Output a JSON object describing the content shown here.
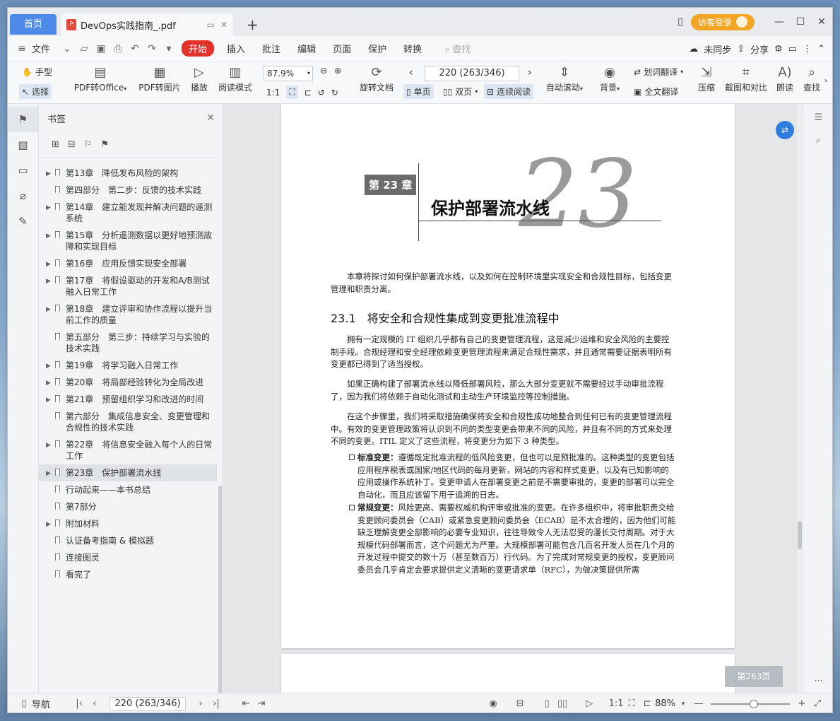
{
  "tabs": {
    "home": "首页",
    "doc": "DevOps实践指南_.pdf",
    "new": "+"
  },
  "titlebar": {
    "login": "访客登录"
  },
  "menu": {
    "file": "文件",
    "items": [
      "开始",
      "插入",
      "批注",
      "编辑",
      "页面",
      "保护",
      "转换"
    ],
    "search": "查找",
    "unsynced": "未同步",
    "share": "分享"
  },
  "ribbon": {
    "hand": "手型",
    "select": "选择",
    "pdf_office": "PDF转Office",
    "pdf_image": "PDF转图片",
    "play": "播放",
    "read_mode": "阅读模式",
    "zoom": "87.9%",
    "page": "220 (263/346)",
    "rotate": "旋转文档",
    "single": "单页",
    "double": "双页",
    "continuous": "连续阅读",
    "autoscroll": "自动滚动",
    "background": "背景",
    "word_translate": "划词翻译",
    "full_translate": "全文翻译",
    "compress": "压缩",
    "screenshot": "截图和对比",
    "read_aloud": "朗读",
    "find": "查找"
  },
  "panel": {
    "title": "书签",
    "bookmarks": [
      {
        "label": "第13章　降低发布风险的架构",
        "arrow": true
      },
      {
        "label": "第四部分　第二步：反馈的技术实践",
        "arrow": false
      },
      {
        "label": "第14章　建立能发现并解决问题的遥测系统",
        "arrow": true
      },
      {
        "label": "第15章　分析遥测数据以更好地预测故障和实现目标",
        "arrow": true
      },
      {
        "label": "第16章　应用反馈实现安全部署",
        "arrow": true
      },
      {
        "label": "第17章　将假设驱动的开发和A/B测试融入日常工作",
        "arrow": true
      },
      {
        "label": "第18章　建立评审和协作流程以提升当前工作的质量",
        "arrow": true
      },
      {
        "label": "第五部分　第三步：持续学习与实验的技术实践",
        "arrow": false
      },
      {
        "label": "第19章　将学习融入日常工作",
        "arrow": true
      },
      {
        "label": "第20章　将局部经验转化为全局改进",
        "arrow": true
      },
      {
        "label": "第21章　预留组织学习和改进的时间",
        "arrow": true
      },
      {
        "label": "第六部分　集成信息安全、变更管理和合规性的技术实践",
        "arrow": false
      },
      {
        "label": "第22章　将信息安全融入每个人的日常工作",
        "arrow": true
      },
      {
        "label": "第23章　保护部署流水线",
        "arrow": true,
        "selected": true
      },
      {
        "label": "行动起来——本书总结",
        "arrow": false
      },
      {
        "label": "第7部分",
        "arrow": false
      },
      {
        "label": "附加材料",
        "arrow": true
      },
      {
        "label": "认证备考指南 & 模拟题",
        "arrow": false
      },
      {
        "label": "连接图灵",
        "arrow": false
      },
      {
        "label": "看完了",
        "arrow": false
      }
    ]
  },
  "document": {
    "chapter_label": "第 23 章",
    "chapter_number": "23",
    "chapter_title": "保护部署流水线",
    "intro": "本章将探讨如何保护部署流水线，以及如何在控制环境里实现安全和合规性目标，包括变更管理和职责分离。",
    "section_title": "23.1　将安全和合规性集成到变更批准流程中",
    "p1": "拥有一定规模的 IT 组织几乎都有自己的变更管理流程，这是减少运维和安全风险的主要控制手段。合规经理和安全经理依赖变更管理流程来满足合规性需求，并且通常需要证据表明所有变更都已得到了适当授权。",
    "p2": "如果正确构建了部署流水线以降低部署风险，那么大部分变更就不需要经过手动审批流程了，因为我们将依赖于自动化测试和主动生产环境监控等控制措施。",
    "p3": "在这个步骤里，我们将采取措施确保将安全和合规性成功地整合到任何已有的变更管理流程中。有效的变更管理政策将认识到不同的类型变更会带来不同的风险，并且有不同的方式来处理不同的变更。ITIL 定义了这些流程，将变更分为如下 3 种类型。",
    "b1_title": "标准变更：",
    "b1": "遵循既定批准流程的低风险变更，但也可以是预批准的。这种类型的变更包括应用程序税表或国家/地区代码的每月更新，网站的内容和样式变更，以及有已知影响的应用或操作系统补丁。变更申请人在部署变更之前是不需要审批的，变更的部署可以完全自动化，而且应该留下用于追溯的日志。",
    "b2_title": "常规变更：",
    "b2": "风险更高、需要权威机构评审或批准的变更。在许多组织中，将审批职责交给变更顾问委员会（CAB）或紧急变更顾问委员会（ECAB）是不太合理的，因为他们可能缺乏理解变更全部影响的必要专业知识，往往导致令人无法忍受的漫长交付周期。对于大规模代码部署而言，这个问题尤为严重。大规模部署可能包含几百名开发人员在几个月的开发过程中提交的数十万（甚至数百万）行代码。为了完成对常规变更的授权，变更顾问委员会几乎肯定会要求提供定义清晰的变更请求单（RFC），为做决策提供所需",
    "page_chip": "第263页"
  },
  "status": {
    "nav": "导航",
    "page": "220 (263/346)",
    "zoom": "88%"
  }
}
